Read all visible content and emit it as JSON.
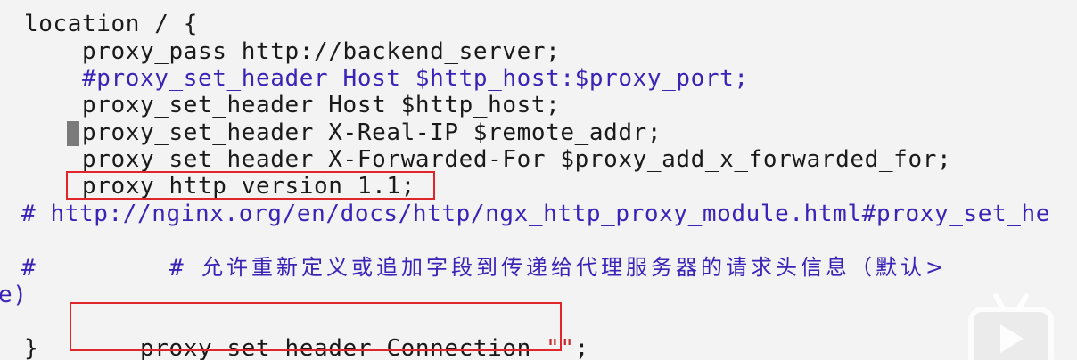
{
  "editor": {
    "lines": [
      {
        "text": "location / {"
      },
      {
        "text": "proxy_pass http://backend_server;"
      },
      {
        "text": "#proxy_set_header Host $http_host:$proxy_port;"
      },
      {
        "text": "proxy_set_header Host $http_host;"
      },
      {
        "text": "proxy_set_header X-Real-IP $remote_addr;"
      },
      {
        "text": "proxy_set_header X-Forwarded-For $proxy_add_x_forwarded_for;"
      },
      {
        "text": "proxy_http_version 1.1;"
      },
      {
        "text": "# http://nginx.org/en/docs/http/ngx_http_proxy_module.html#proxy_set_he"
      },
      {
        "text_hash": "#",
        "text_hash2": "#",
        "text_cjk": "允许重新定义或追加字段到传递给代理服务器的请求头信息（默认>"
      },
      {
        "text": "e)"
      },
      {
        "text_code": "proxy_set_header Connection ",
        "text_string": "\"\"",
        "text_end": ";"
      },
      {
        "text": "}"
      }
    ]
  },
  "colors": {
    "code": "#1a1a1a",
    "comment": "#3b23b8",
    "string": "#c62828",
    "highlight": "#e0262a",
    "background": "#f3f3f3"
  },
  "icons": {
    "watermark": "bilibili-play-icon"
  }
}
